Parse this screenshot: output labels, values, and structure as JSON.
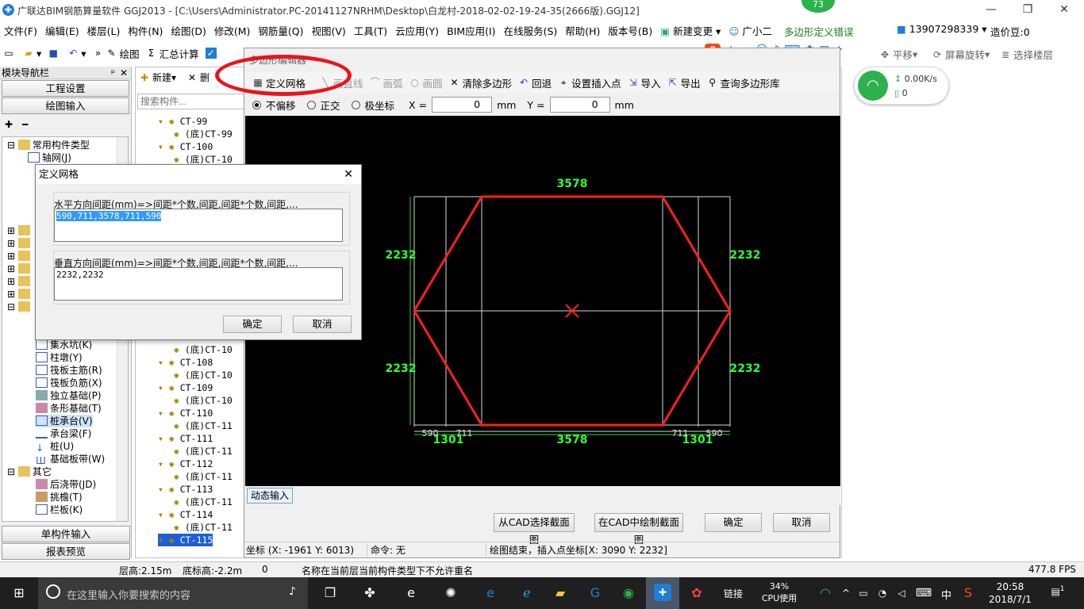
{
  "window": {
    "title": "广联达BIM钢筋算量软件 GGJ2013 - [C:\\Users\\Administrator.PC-20141127NRHM\\Desktop\\白龙村-2018-02-02-19-24-35(2666版).GGJ12]",
    "badge": "73"
  },
  "menu": [
    "文件(F)",
    "编辑(E)",
    "楼层(L)",
    "构件(N)",
    "绘图(D)",
    "修改(M)",
    "钢筋量(Q)",
    "视图(V)",
    "工具(T)",
    "云应用(Y)",
    "BIM应用(I)",
    "在线服务(S)",
    "帮助(H)",
    "版本号(B)",
    "新建变更",
    "广小二"
  ],
  "menu_right": {
    "error_msg": "多边形定义错误",
    "phone": "13907298339",
    "price": "造价豆:0"
  },
  "toolbar": {
    "draw": "绘图",
    "sum": "汇总计算",
    "pan": "平移",
    "rotate": "屏幕旋转",
    "select_floor": "选择楼层",
    "ime": "中"
  },
  "nav": {
    "title": "模块导航栏",
    "btn_project": "工程设置",
    "btn_draw_input": "绘图输入",
    "btn_single": "单构件输入",
    "btn_report": "报表预览",
    "tree": [
      {
        "label": "常用构件类型",
        "level": 1
      },
      {
        "label": "轴网(J)",
        "level": 2
      },
      {
        "label": "集水坑(K)",
        "level": 2
      },
      {
        "label": "柱墩(Y)",
        "level": 2
      },
      {
        "label": "筏板主筋(R)",
        "level": 2
      },
      {
        "label": "筏板负筋(X)",
        "level": 2
      },
      {
        "label": "独立基础(P)",
        "level": 2
      },
      {
        "label": "条形基础(T)",
        "level": 2
      },
      {
        "label": "桩承台(V)",
        "level": 2
      },
      {
        "label": "承台梁(F)",
        "level": 2
      },
      {
        "label": "桩(U)",
        "level": 2
      },
      {
        "label": "基础板带(W)",
        "level": 2
      },
      {
        "label": "其它",
        "level": 1
      },
      {
        "label": "后浇带(JD)",
        "level": 2
      },
      {
        "label": "挑檐(T)",
        "level": 2
      },
      {
        "label": "栏板(K)",
        "level": 2
      }
    ]
  },
  "components": {
    "new": "新建",
    "delete": "删",
    "search_placeholder": "搜索构件...",
    "items": [
      "CT-99",
      "(底)CT-99",
      "CT-100",
      "(底)CT-10",
      "(底)CT-10",
      "CT-108",
      "(底)CT-10",
      "CT-109",
      "(底)CT-10",
      "CT-110",
      "(底)CT-11",
      "CT-111",
      "(底)CT-11",
      "CT-112",
      "(底)CT-11",
      "CT-113",
      "(底)CT-11",
      "CT-114",
      "(底)CT-11",
      "CT-115"
    ]
  },
  "dialog": {
    "title_partial": "多边形编辑器",
    "tools": [
      "定义网格",
      "画直线",
      "画弧",
      "画圆",
      "清除多边形",
      "回退",
      "设置插入点",
      "导入",
      "导出",
      "查询多边形库"
    ],
    "options": {
      "no_offset": "不偏移",
      "ortho": "正交",
      "polar": "极坐标",
      "x_label": "X =",
      "x_value": "0",
      "y_label": "Y =",
      "y_value": "0",
      "unit": "mm"
    },
    "dims": {
      "top": "3578",
      "bottom": "3578",
      "left_top": "2232",
      "left_bottom": "2232",
      "right_top": "2232",
      "right_bottom": "2232",
      "b1": "590",
      "b2": "711",
      "b3": "711",
      "b4": "590",
      "b_left": "1301",
      "b_right": "1301"
    },
    "dyn_input": "动态输入",
    "btn_cad_select": "从CAD选择截面图",
    "btn_cad_draw": "在CAD中绘制截面图",
    "btn_ok": "确定",
    "btn_cancel": "取消",
    "status_coord": "坐标 (X: -1961 Y: 6013)",
    "status_cmd": "命令: 无",
    "status_msg": "绘图结束，插入点坐标[X: 3090 Y: 2232]"
  },
  "grid_dialog": {
    "title": "定义网格",
    "h_label": "水平方向间距(mm)=>间距*个数,间距,间距*个数,间距,...",
    "h_value": "590,711,3578,711,590",
    "v_label": "垂直方向间距(mm)=>间距*个数,间距,间距*个数,间距,...",
    "v_value": "2232,2232",
    "ok": "确定",
    "cancel": "取消"
  },
  "net": {
    "speed": "0.00K/s",
    "count": "0"
  },
  "statusbar": {
    "floor_h": "层高:2.15m",
    "bottom_h": "底标高:-2.2m",
    "zero": "0",
    "msg": "名称在当前层当前构件类型下不允许重名",
    "fps": "477.8 FPS"
  },
  "taskbar": {
    "search": "在这里输入你要搜索的内容",
    "link": "链接",
    "cpu_pct": "34%",
    "cpu_label": "CPU使用",
    "lang": "中",
    "time": "20:58",
    "date": "2018/7/1",
    "notif": "1"
  },
  "colors": {
    "highlight_oval": "#e8141b",
    "canvas": "#000000",
    "poly": "#ff1f1f",
    "dim_text": "#31ff31",
    "grid": "#d8d8d8"
  }
}
